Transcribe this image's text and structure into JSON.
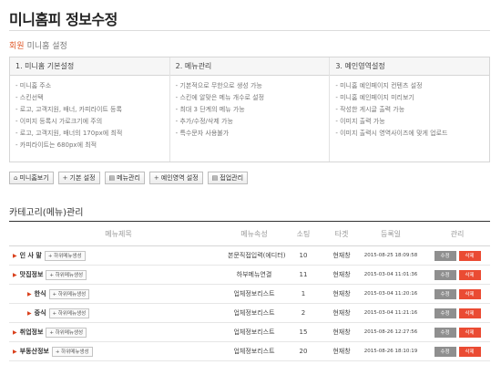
{
  "page": {
    "title": "미니홈피 정보수정"
  },
  "breadcrumb": {
    "main": "회원",
    "sub": "미니홈 설정"
  },
  "settings": {
    "columns": [
      {
        "heading": "1. 미니홈 기본설정",
        "items": [
          "미니홈 주소",
          "스킨선택",
          "로고, 고객지원, 배너, 카피라이트 등록",
          "이미지 등록시 가로크기에 주의",
          "로고, 고객지원, 배너의 170px에 최적",
          "카피라이트는 680px에 최적"
        ]
      },
      {
        "heading": "2. 메뉴관리",
        "items": [
          "기본적으로 무한으로 생성 가능",
          "스킨에 알맞은 메뉴 개수로 설정",
          "최대 3 단계의 메뉴 가능",
          "추가/수정/삭제 가능",
          "특수문자 사용불가"
        ]
      },
      {
        "heading": "3. 예인영역설정",
        "items": [
          "미니홈 예인페이지 컨텐츠 설정",
          "미니홈 예인페이지 미리보기",
          "작성한 게시글 출력 가능",
          "이미지 출력 가능",
          "이미지 출력시 영역사이즈에 맞게 업로드"
        ]
      }
    ]
  },
  "toolbar": {
    "buttons": [
      {
        "icon": "⌂",
        "label": "미니홈보기"
      },
      {
        "icon": "+",
        "label": "기본 설정"
      },
      {
        "icon": "▤",
        "label": "메뉴관리"
      },
      {
        "icon": "+",
        "label": "예인영역 설정"
      },
      {
        "icon": "▤",
        "label": "접업관리"
      }
    ]
  },
  "menu_section": {
    "title": "카테고리(메뉴)관리",
    "headers": {
      "name": "메뉴제목",
      "attr": "메뉴속성",
      "sort": "소팅",
      "target": "타겟",
      "date": "등록일",
      "manage": "관리"
    },
    "sub_button_label": "+ 하위메뉴생성",
    "edit_label": "수정",
    "delete_label": "삭제",
    "rows": [
      {
        "name": "인 사 말",
        "level": 1,
        "attr": "본문직접입력(에디터)",
        "sort": "10",
        "target": "현재창",
        "date": "2015-08-25 18:09:58"
      },
      {
        "name": "맛집정보",
        "level": 1,
        "attr": "하부메뉴연결",
        "sort": "11",
        "target": "현재창",
        "date": "2015-03-04 11:01:36"
      },
      {
        "name": "한식",
        "level": 2,
        "attr": "업체정보리스트",
        "sort": "1",
        "target": "현재창",
        "date": "2015-03-04 11:20:16"
      },
      {
        "name": "중식",
        "level": 2,
        "attr": "업체정보리스트",
        "sort": "2",
        "target": "현재창",
        "date": "2015-03-04 11:21:16"
      },
      {
        "name": "취업정보",
        "level": 1,
        "attr": "업체정보리스트",
        "sort": "15",
        "target": "현재창",
        "date": "2015-08-26 12:27:56"
      },
      {
        "name": "부동산정보",
        "level": 1,
        "attr": "업체정보리스트",
        "sort": "20",
        "target": "현재창",
        "date": "2015-08-26 18:10:19"
      }
    ]
  }
}
